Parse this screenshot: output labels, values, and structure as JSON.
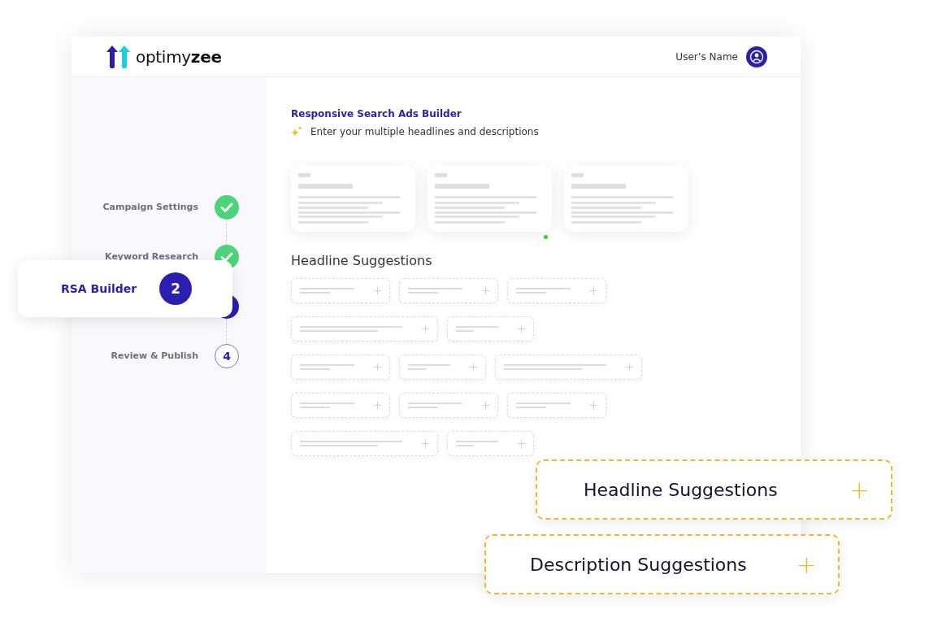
{
  "header": {
    "brand_light": "optimy",
    "brand_bold": "zee",
    "user_name": "User’s Name"
  },
  "steps": [
    {
      "label": "Campaign Settings",
      "done": true,
      "current": false
    },
    {
      "label": "Keyword Research",
      "done": true,
      "current": false
    },
    {
      "done": false,
      "current": true
    },
    {
      "label": "Review & Publish",
      "done": false,
      "current": false,
      "number": "4"
    }
  ],
  "current_step_card": {
    "label": "RSA Builder",
    "number": "2"
  },
  "content": {
    "title": "Responsive Search Ads Builder",
    "subtitle": "Enter your multiple headlines and descriptions",
    "section_heading": "Headline Suggestions"
  },
  "suggestion_cards": [
    {
      "label": "Headline Suggestions",
      "icon": "+"
    },
    {
      "label": "Description Suggestions",
      "icon": "+"
    }
  ]
}
